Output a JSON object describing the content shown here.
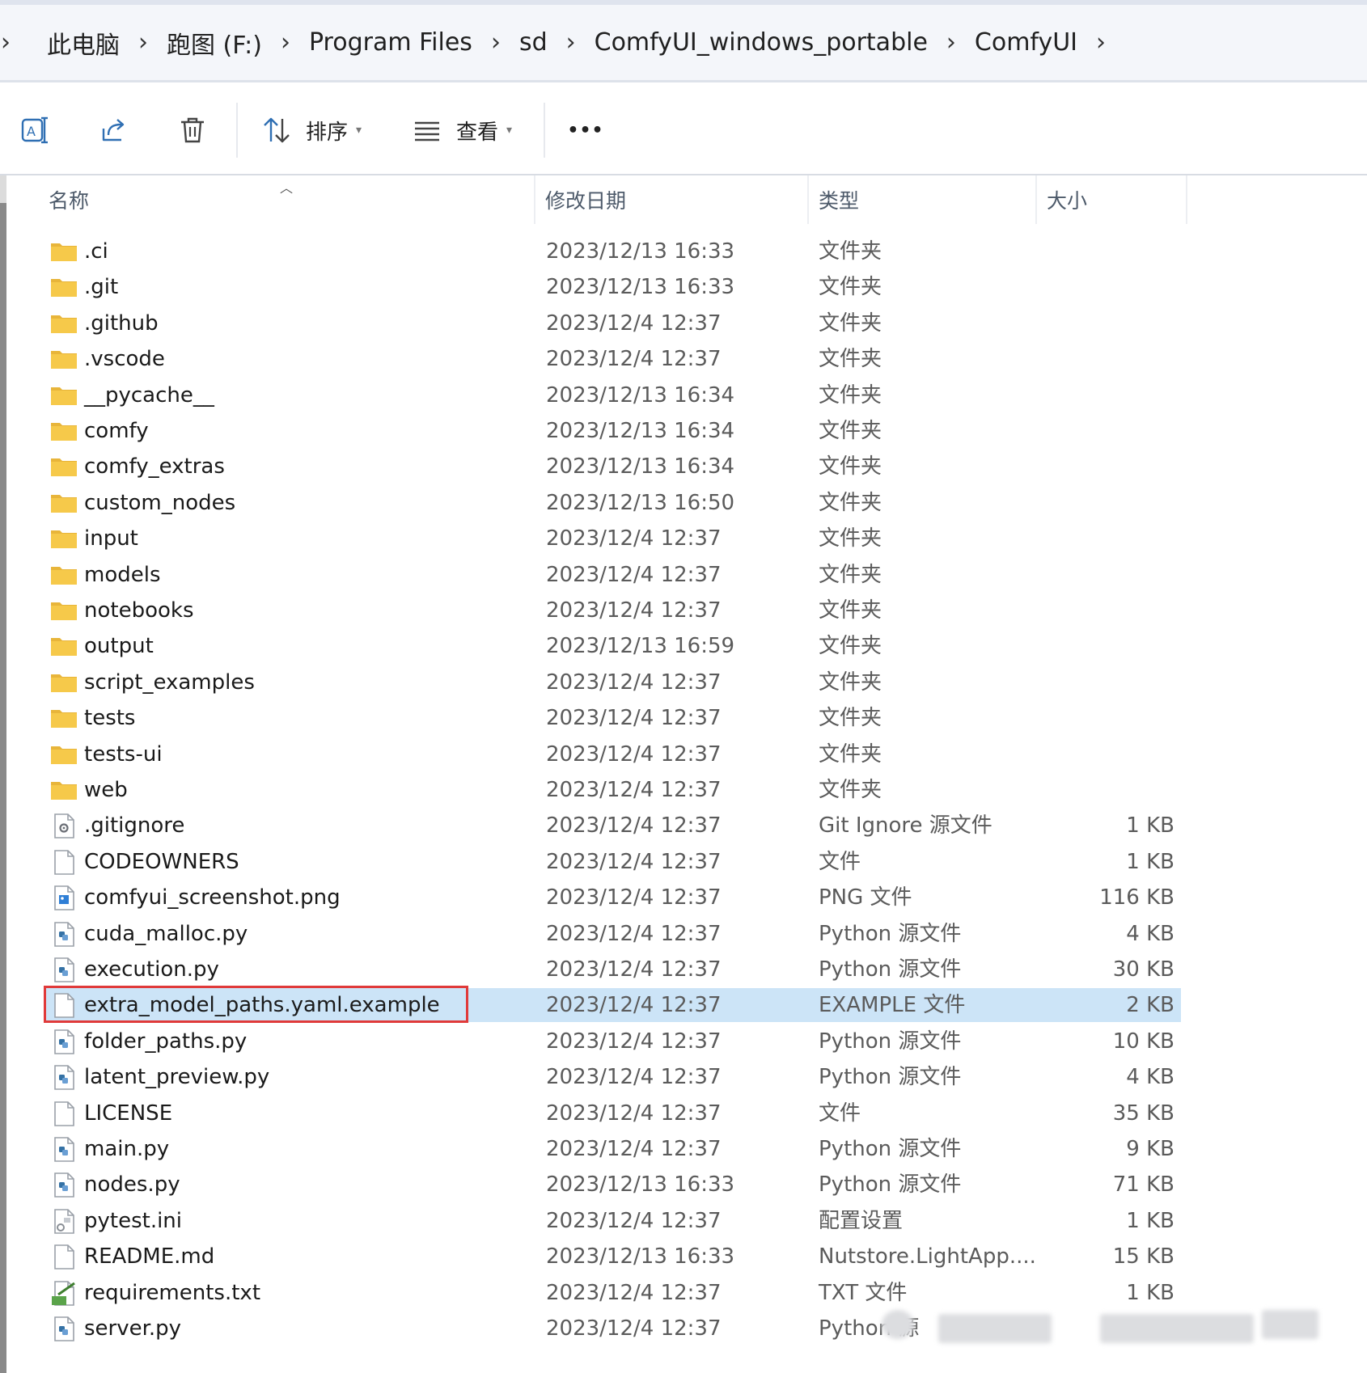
{
  "breadcrumb": {
    "items": [
      "此电脑",
      "跑图 (F:)",
      "Program Files",
      "sd",
      "ComfyUI_windows_portable",
      "ComfyUI"
    ],
    "separator": "›"
  },
  "toolbar": {
    "sort_label": "排序",
    "view_label": "查看",
    "more_label": "•••",
    "icons": [
      "rename-icon",
      "share-icon",
      "delete-icon",
      "sort-icon",
      "view-icon",
      "more-icon"
    ]
  },
  "columns": {
    "name": "名称",
    "date": "修改日期",
    "type": "类型",
    "size": "大小"
  },
  "files": [
    {
      "name": ".ci",
      "date": "2023/12/13 16:33",
      "type": "文件夹",
      "size": "",
      "icon": "folder"
    },
    {
      "name": ".git",
      "date": "2023/12/13 16:33",
      "type": "文件夹",
      "size": "",
      "icon": "folder"
    },
    {
      "name": ".github",
      "date": "2023/12/4 12:37",
      "type": "文件夹",
      "size": "",
      "icon": "folder"
    },
    {
      "name": ".vscode",
      "date": "2023/12/4 12:37",
      "type": "文件夹",
      "size": "",
      "icon": "folder"
    },
    {
      "name": "__pycache__",
      "date": "2023/12/13 16:34",
      "type": "文件夹",
      "size": "",
      "icon": "folder"
    },
    {
      "name": "comfy",
      "date": "2023/12/13 16:34",
      "type": "文件夹",
      "size": "",
      "icon": "folder"
    },
    {
      "name": "comfy_extras",
      "date": "2023/12/13 16:34",
      "type": "文件夹",
      "size": "",
      "icon": "folder"
    },
    {
      "name": "custom_nodes",
      "date": "2023/12/13 16:50",
      "type": "文件夹",
      "size": "",
      "icon": "folder"
    },
    {
      "name": "input",
      "date": "2023/12/4 12:37",
      "type": "文件夹",
      "size": "",
      "icon": "folder"
    },
    {
      "name": "models",
      "date": "2023/12/4 12:37",
      "type": "文件夹",
      "size": "",
      "icon": "folder"
    },
    {
      "name": "notebooks",
      "date": "2023/12/4 12:37",
      "type": "文件夹",
      "size": "",
      "icon": "folder"
    },
    {
      "name": "output",
      "date": "2023/12/13 16:59",
      "type": "文件夹",
      "size": "",
      "icon": "folder"
    },
    {
      "name": "script_examples",
      "date": "2023/12/4 12:37",
      "type": "文件夹",
      "size": "",
      "icon": "folder"
    },
    {
      "name": "tests",
      "date": "2023/12/4 12:37",
      "type": "文件夹",
      "size": "",
      "icon": "folder"
    },
    {
      "name": "tests-ui",
      "date": "2023/12/4 12:37",
      "type": "文件夹",
      "size": "",
      "icon": "folder"
    },
    {
      "name": "web",
      "date": "2023/12/4 12:37",
      "type": "文件夹",
      "size": "",
      "icon": "folder"
    },
    {
      "name": ".gitignore",
      "date": "2023/12/4 12:37",
      "type": "Git Ignore 源文件",
      "size": "1 KB",
      "icon": "gear-file"
    },
    {
      "name": "CODEOWNERS",
      "date": "2023/12/4 12:37",
      "type": "文件",
      "size": "1 KB",
      "icon": "blank-file"
    },
    {
      "name": "comfyui_screenshot.png",
      "date": "2023/12/4 12:37",
      "type": "PNG 文件",
      "size": "116 KB",
      "icon": "image-file"
    },
    {
      "name": "cuda_malloc.py",
      "date": "2023/12/4 12:37",
      "type": "Python 源文件",
      "size": "4 KB",
      "icon": "python-file"
    },
    {
      "name": "execution.py",
      "date": "2023/12/4 12:37",
      "type": "Python 源文件",
      "size": "30 KB",
      "icon": "python-file"
    },
    {
      "name": "extra_model_paths.yaml.example",
      "date": "2023/12/4 12:37",
      "type": "EXAMPLE 文件",
      "size": "2 KB",
      "icon": "blank-file",
      "selected": true
    },
    {
      "name": "folder_paths.py",
      "date": "2023/12/4 12:37",
      "type": "Python 源文件",
      "size": "10 KB",
      "icon": "python-file"
    },
    {
      "name": "latent_preview.py",
      "date": "2023/12/4 12:37",
      "type": "Python 源文件",
      "size": "4 KB",
      "icon": "python-file"
    },
    {
      "name": "LICENSE",
      "date": "2023/12/4 12:37",
      "type": "文件",
      "size": "35 KB",
      "icon": "blank-file"
    },
    {
      "name": "main.py",
      "date": "2023/12/4 12:37",
      "type": "Python 源文件",
      "size": "9 KB",
      "icon": "python-file"
    },
    {
      "name": "nodes.py",
      "date": "2023/12/13 16:33",
      "type": "Python 源文件",
      "size": "71 KB",
      "icon": "python-file"
    },
    {
      "name": "pytest.ini",
      "date": "2023/12/4 12:37",
      "type": "配置设置",
      "size": "1 KB",
      "icon": "settings-file"
    },
    {
      "name": "README.md",
      "date": "2023/12/13 16:33",
      "type": "Nutstore.LightApp....",
      "size": "15 KB",
      "icon": "blank-file"
    },
    {
      "name": "requirements.txt",
      "date": "2023/12/4 12:37",
      "type": "TXT 文件",
      "size": "1 KB",
      "icon": "text-file"
    },
    {
      "name": "server.py",
      "date": "2023/12/4 12:37",
      "type": "Python 源",
      "size": "",
      "icon": "python-file"
    }
  ],
  "colors": {
    "selection": "#cce4f7",
    "highlight_box": "#e03a3a",
    "folder": "#f6c94a"
  }
}
